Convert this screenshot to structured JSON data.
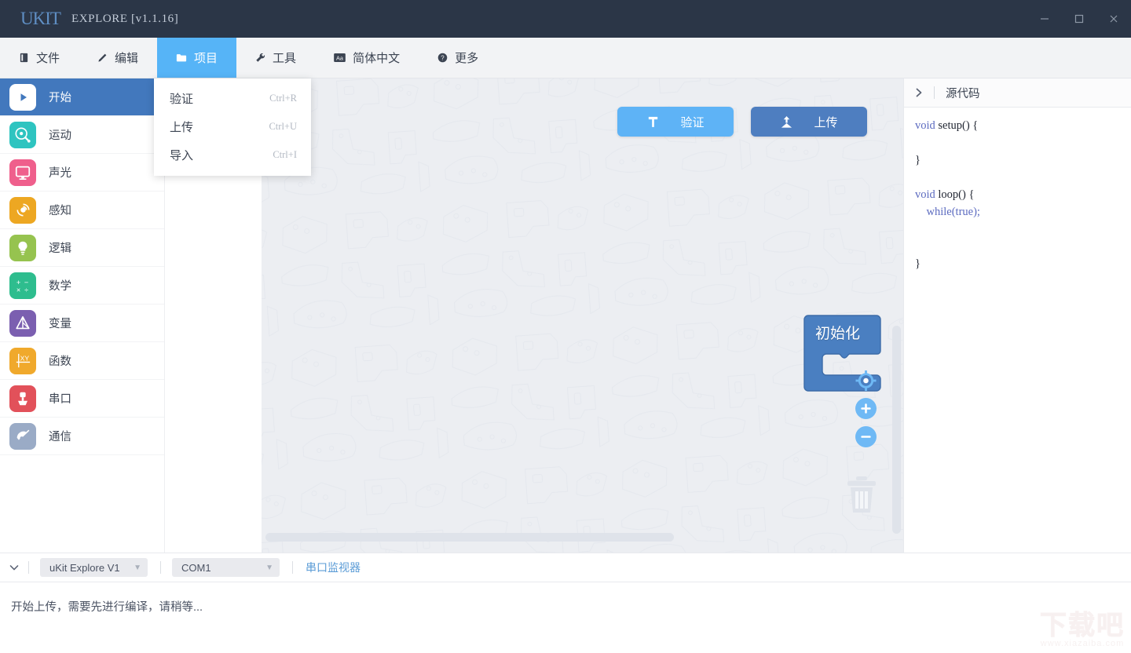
{
  "titlebar": {
    "logo": "UKIT",
    "title": "EXPLORE [v1.1.16]",
    "minimize_label": "minimize",
    "maximize_label": "maximize",
    "close_label": "close"
  },
  "menubar": {
    "items": [
      {
        "label": "文件",
        "icon": "file-icon",
        "active": false
      },
      {
        "label": "编辑",
        "icon": "edit-icon",
        "active": false
      },
      {
        "label": "项目",
        "icon": "folder-icon",
        "active": true
      },
      {
        "label": "工具",
        "icon": "wrench-icon",
        "active": false
      },
      {
        "label": "简体中文",
        "icon": "language-icon",
        "active": false
      },
      {
        "label": "更多",
        "icon": "help-icon",
        "active": false
      }
    ]
  },
  "dropdown": {
    "open_for": "项目",
    "items": [
      {
        "label": "验证",
        "shortcut": "Ctrl+R"
      },
      {
        "label": "上传",
        "shortcut": "Ctrl+U"
      },
      {
        "label": "导入",
        "shortcut": "Ctrl+I"
      }
    ]
  },
  "sidebar": {
    "items": [
      {
        "label": "开始",
        "icon": "play-icon",
        "color": "#4278bd",
        "active": true
      },
      {
        "label": "运动",
        "icon": "motion-icon",
        "color": "#2ec4c0",
        "active": false
      },
      {
        "label": "声光",
        "icon": "display-icon",
        "color": "#ef5f8c",
        "active": false
      },
      {
        "label": "感知",
        "icon": "sensor-icon",
        "color": "#eda722",
        "active": false
      },
      {
        "label": "逻辑",
        "icon": "bulb-icon",
        "color": "#96c34f",
        "active": false
      },
      {
        "label": "数学",
        "icon": "math-icon",
        "color": "#2ebd8e",
        "active": false
      },
      {
        "label": "变量",
        "icon": "variable-icon",
        "color": "#7b5fb0",
        "active": false
      },
      {
        "label": "函数",
        "icon": "function-icon",
        "color": "#f0a92c",
        "active": false
      },
      {
        "label": "串口",
        "icon": "usb-icon",
        "color": "#e2515a",
        "active": false
      },
      {
        "label": "通信",
        "icon": "antenna-icon",
        "color": "#9aabc6",
        "active": false
      }
    ]
  },
  "canvas": {
    "toolbar": [
      {
        "label": "验证",
        "icon": "hammer-icon",
        "color": "#5eb3f6",
        "id": "verify"
      },
      {
        "label": "上传",
        "icon": "upload-icon",
        "color": "#4e7ec0",
        "id": "upload"
      }
    ],
    "blocks": [
      {
        "label": "初始化",
        "type": "c-block",
        "color": "#4a7fc1"
      }
    ],
    "zoom_controls": [
      {
        "icon": "center-target-icon",
        "name": "zoom-reset"
      },
      {
        "icon": "plus-icon",
        "name": "zoom-in"
      },
      {
        "icon": "minus-icon",
        "name": "zoom-out"
      }
    ],
    "trash_icon": "trash-icon"
  },
  "source_panel": {
    "collapse_icon": "chevron-right-icon",
    "title": "源代码",
    "code_lines": [
      {
        "segments": [
          {
            "t": "void ",
            "c": "kw"
          },
          {
            "t": "setup() {",
            "c": "fn"
          }
        ]
      },
      {
        "segments": []
      },
      {
        "segments": [
          {
            "t": "}",
            "c": "fn"
          }
        ]
      },
      {
        "segments": []
      },
      {
        "segments": [
          {
            "t": "void ",
            "c": "kw"
          },
          {
            "t": "loop() {",
            "c": "fn"
          }
        ]
      },
      {
        "segments": [
          {
            "t": "    ",
            "c": "fn"
          },
          {
            "t": "while(true);",
            "c": "ctl"
          }
        ]
      },
      {
        "segments": []
      },
      {
        "segments": []
      },
      {
        "segments": [
          {
            "t": "}",
            "c": "fn"
          }
        ]
      }
    ]
  },
  "statusbar": {
    "caret_icon": "chevron-down-icon",
    "board_select": {
      "value": "uKit Explore V1",
      "caret": "▼"
    },
    "port_select": {
      "value": "COM1",
      "caret": "▼"
    },
    "serial_monitor_label": "串口监视器"
  },
  "log": {
    "message": "开始上传，需要先进行编译，请稍等..."
  },
  "watermark": {
    "big": "下载吧",
    "small": "www.xiazaiba.com"
  },
  "colors": {
    "titlebar_bg": "#2b3647",
    "menubar_bg": "#f2f3f5",
    "menu_active": "#56b4f7",
    "sidebar_active": "#4278bd",
    "canvas_bg": "#eceef2",
    "accent_blue": "#5eb3f6",
    "upload_blue": "#4e7ec0",
    "link_blue": "#5a9bd6"
  }
}
